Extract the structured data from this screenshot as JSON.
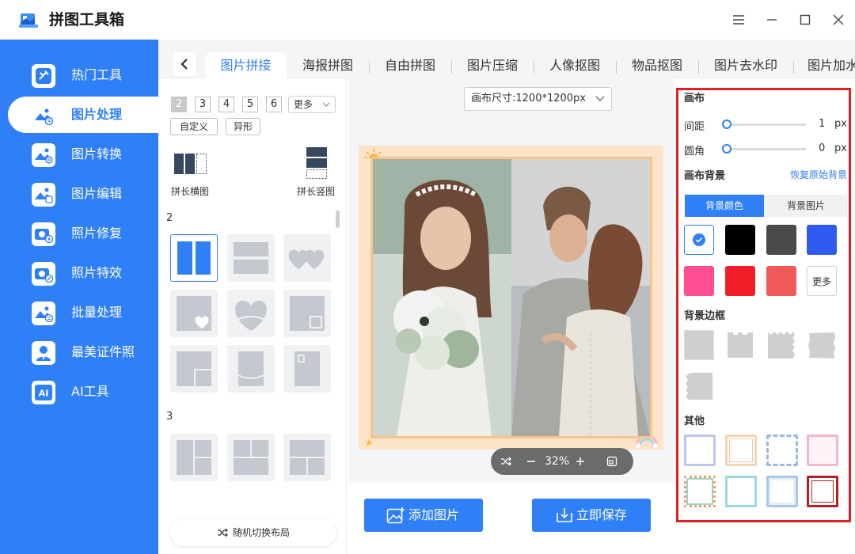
{
  "app": {
    "title": "拼图工具箱"
  },
  "sidebar": {
    "items": [
      {
        "label": "热门工具"
      },
      {
        "label": "图片处理"
      },
      {
        "label": "图片转换"
      },
      {
        "label": "图片编辑"
      },
      {
        "label": "照片修复"
      },
      {
        "label": "照片特效"
      },
      {
        "label": "批量处理"
      },
      {
        "label": "最美证件照"
      },
      {
        "label": "AI工具"
      }
    ],
    "ai_glyph": "AI"
  },
  "tabs": [
    {
      "label": "图片拼接"
    },
    {
      "label": "海报拼图"
    },
    {
      "label": "自由拼图"
    },
    {
      "label": "图片压缩"
    },
    {
      "label": "人像抠图"
    },
    {
      "label": "物品抠图"
    },
    {
      "label": "图片去水印"
    },
    {
      "label": "图片加水"
    }
  ],
  "layout": {
    "counts": [
      "2",
      "3",
      "4",
      "5",
      "6"
    ],
    "more": "更多",
    "custom": "自定义",
    "irregular": "异形",
    "long_h": "拼长横图",
    "long_v": "拼长竖图",
    "section2": "2",
    "section3": "3",
    "random": "随机切换布局"
  },
  "canvas": {
    "size_label": "画布尺寸:1200*1200px",
    "zoom": "32%",
    "add_image": "添加图片",
    "save": "立即保存"
  },
  "settings": {
    "canvas_title": "画布",
    "spacing_label": "间距",
    "spacing_value": "1",
    "spacing_unit": "px",
    "spacing_level": 0.0,
    "radius_label": "圆角",
    "radius_value": "0",
    "radius_unit": "px",
    "radius_level": 0.0,
    "bg_title": "画布背景",
    "restore": "恢复原始背景",
    "bg_color_tab": "背景颜色",
    "bg_image_tab": "背景图片",
    "colors": [
      "#ffffff",
      "#000000",
      "#4a4a4a",
      "#2f5bf0",
      "#ff4f92",
      "#f01e28",
      "#f05a5a"
    ],
    "more": "更多",
    "border_title": "背景边框",
    "other_title": "其他"
  },
  "colors": {
    "accent": "#2f7ff7",
    "highlight": "#e02020"
  }
}
